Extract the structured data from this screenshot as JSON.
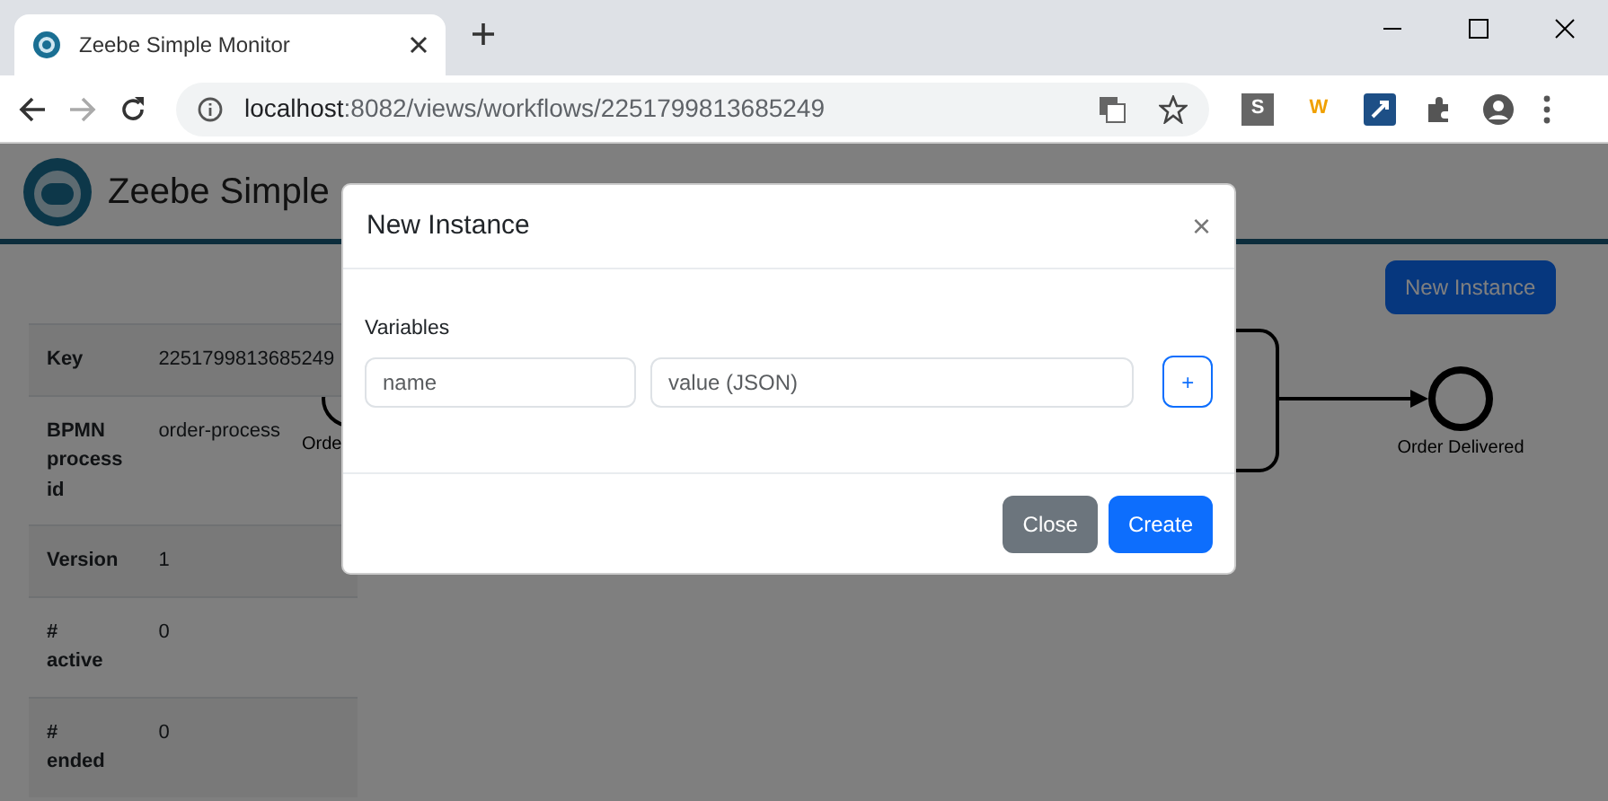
{
  "browser": {
    "tab_title": "Zeebe Simple Monitor",
    "url_host": "localhost",
    "url_rest": ":8082/views/workflows/2251799813685249",
    "extension_s": "S",
    "extension_w": "W"
  },
  "page": {
    "title": "Zeebe Simple",
    "new_instance_button": "New Instance",
    "details": [
      {
        "label": "Key",
        "value": "2251799813685249"
      },
      {
        "label": "BPMN process id",
        "value": "order-process"
      },
      {
        "label": "Version",
        "value": "1"
      },
      {
        "label": "# active",
        "value": "0"
      },
      {
        "label": "# ended",
        "value": "0"
      }
    ],
    "diagram": {
      "start_label": "Orde",
      "end_label": "Order Delivered"
    }
  },
  "modal": {
    "title": "New Instance",
    "close_symbol": "×",
    "variables_label": "Variables",
    "name_placeholder": "name",
    "value_placeholder": "value (JSON)",
    "add_button": "+",
    "buttons": [
      {
        "kind": "secondary",
        "label": "Close"
      },
      {
        "kind": "primary",
        "label": "Create"
      }
    ]
  }
}
